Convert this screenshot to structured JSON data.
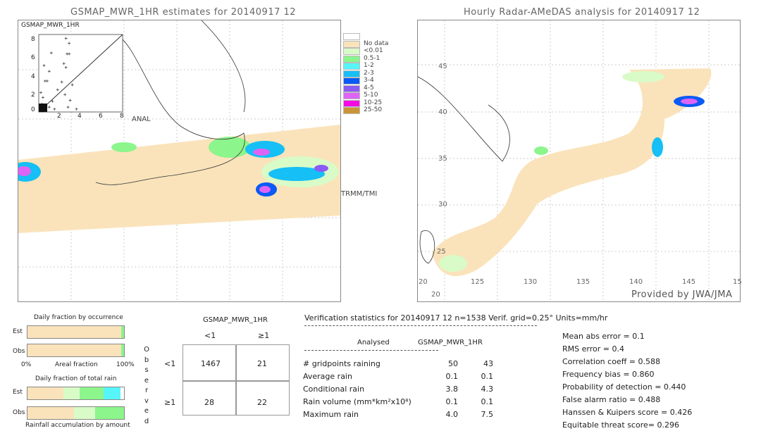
{
  "left_map": {
    "title": "GSMAP_MWR_1HR estimates for 20140917 12",
    "swath_label": "TRMM/TMI",
    "anal_label": "ANAL",
    "scatter": {
      "title": "GSMAP_MWR_1HR",
      "xticks": [
        "2",
        "4",
        "6",
        "8"
      ],
      "yticks": [
        "0",
        "2",
        "4",
        "6",
        "8"
      ],
      "xlim": [
        0,
        8
      ],
      "ylim": [
        0,
        8
      ]
    }
  },
  "right_map": {
    "title": "Hourly Radar-AMeDAS analysis for 20140917 12",
    "credit": "Provided by JWA/JMA",
    "lat_labels": [
      "45",
      "40",
      "35",
      "30",
      "25",
      "20"
    ],
    "lon_labels": [
      "125",
      "130",
      "135",
      "140",
      "145",
      "15"
    ],
    "corner_label": "20"
  },
  "legend": {
    "items": [
      {
        "label": "",
        "color": "#ffffff"
      },
      {
        "label": "No data",
        "color": "#fae3bb"
      },
      {
        "label": "<0.01",
        "color": "#d9fbc8"
      },
      {
        "label": "0.5-1",
        "color": "#8cf58c"
      },
      {
        "label": "1-2",
        "color": "#55f5fa"
      },
      {
        "label": "2-3",
        "color": "#16bff5"
      },
      {
        "label": "3-4",
        "color": "#0a5af5"
      },
      {
        "label": "4-5",
        "color": "#8c5af5"
      },
      {
        "label": "5-10",
        "color": "#de64f5"
      },
      {
        "label": "10-25",
        "color": "#f50ae6"
      },
      {
        "label": "25-50",
        "color": "#c89637"
      }
    ]
  },
  "occurrence": {
    "title": "Daily fraction by occurrence",
    "est": "Est",
    "obs": "Obs",
    "x0": "0%",
    "xlabel": "Areal fraction",
    "x1": "100%",
    "est_fractions": [
      0.97,
      0.03
    ],
    "obs_fractions": [
      0.97,
      0.03
    ]
  },
  "total_rain": {
    "title": "Daily fraction of total rain",
    "est": "Est",
    "obs": "Obs",
    "xlabel": "Rainfall accumulation by amount",
    "est_fractions": [
      0.37,
      0.17,
      0.25,
      0.17
    ],
    "obs_fractions": [
      0.48,
      0.22,
      0.3
    ]
  },
  "contingency": {
    "title": "GSMAP_MWR_1HR",
    "col_labels": [
      "<1",
      "≥1"
    ],
    "row_labels": [
      "<1",
      "≥1"
    ],
    "side_label": [
      "O",
      "b",
      "s",
      "e",
      "r",
      "v",
      "e",
      "d"
    ],
    "cells": [
      [
        "1467",
        "21"
      ],
      [
        "28",
        "22"
      ]
    ]
  },
  "stats": {
    "header": "Verification statistics for 20140917 12   n=1538   Verif. grid=0.25°   Units=mm/hr",
    "col_analysed": "Analysed",
    "col_est": "GSMAP_MWR_1HR",
    "rows": [
      {
        "label": "# gridpoints raining",
        "a": "50",
        "e": "43"
      },
      {
        "label": "Average rain",
        "a": "0.1",
        "e": "0.1"
      },
      {
        "label": "Conditional rain",
        "a": "3.8",
        "e": "4.3"
      },
      {
        "label": "Rain volume (mm*km²x10⁸)",
        "a": "0.1",
        "e": "0.1"
      },
      {
        "label": "Maximum rain",
        "a": "4.0",
        "e": "7.5"
      }
    ],
    "scores": [
      "Mean abs error = 0.1",
      "RMS error = 0.4",
      "Correlation coeff = 0.588",
      "Frequency bias = 0.860",
      "Probability of detection = 0.440",
      "False alarm ratio = 0.488",
      "Hanssen & Kuipers score = 0.426",
      "Equitable threat score= 0.296"
    ]
  }
}
